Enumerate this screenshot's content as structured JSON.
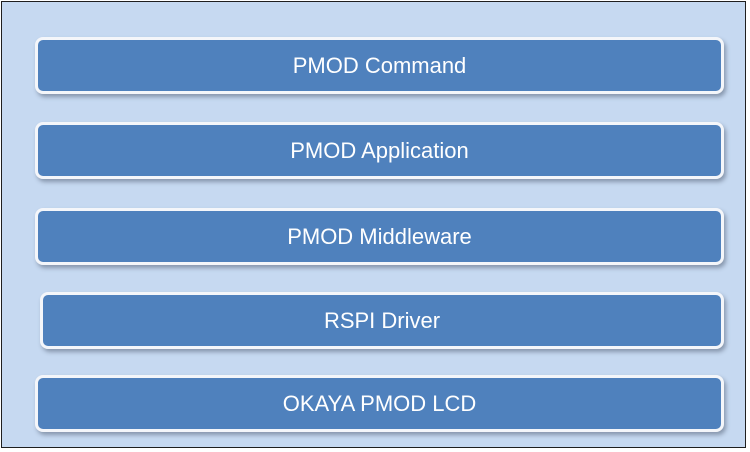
{
  "stack": {
    "layers": [
      {
        "label": "PMOD Command"
      },
      {
        "label": "PMOD Application"
      },
      {
        "label": "PMOD Middleware"
      },
      {
        "label": "RSPI Driver"
      },
      {
        "label": "OKAYA PMOD LCD"
      }
    ]
  },
  "colors": {
    "background": "#c6d9f1",
    "layer_fill": "#4f81bd",
    "layer_border": "#f4f6fa",
    "text": "#ffffff"
  }
}
